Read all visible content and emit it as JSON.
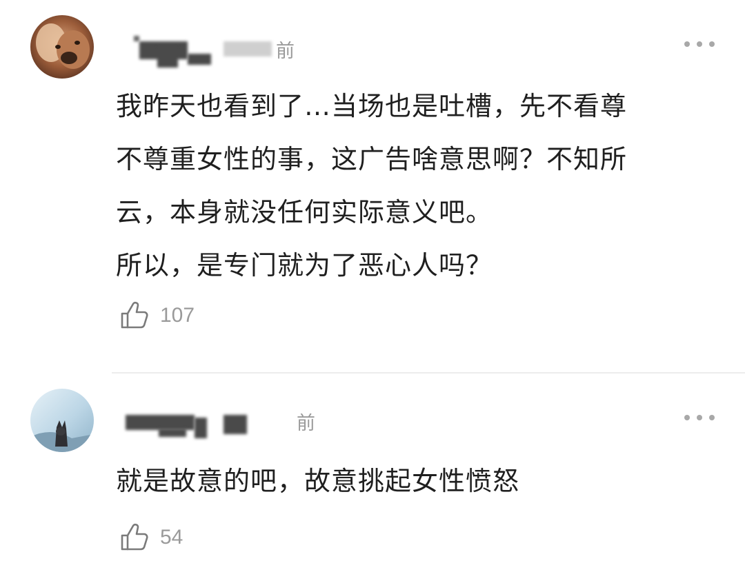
{
  "comments": [
    {
      "time_text": "前",
      "content_lines": [
        "我昨天也看到了…当场也是吐槽，先不看尊",
        "不尊重女性的事，这广告啥意思啊？不知所",
        "云，本身就没任何实际意义吧。",
        "所以，是专门就为了恶心人吗？"
      ],
      "like_count": "107",
      "avatar_icon": "dog-avatar-icon",
      "more_icon": "more-options-icon",
      "like_icon": "thumbs-up-icon"
    },
    {
      "time_text": "前",
      "content_lines": [
        "就是故意的吧，故意挑起女性愤怒"
      ],
      "like_count": "54",
      "avatar_icon": "cat-avatar-icon",
      "more_icon": "more-options-icon",
      "like_icon": "thumbs-up-icon"
    }
  ],
  "colors": {
    "text": "#1f1f1f",
    "muted": "#9a9a9a",
    "divider": "#ececec",
    "background": "#ffffff"
  }
}
